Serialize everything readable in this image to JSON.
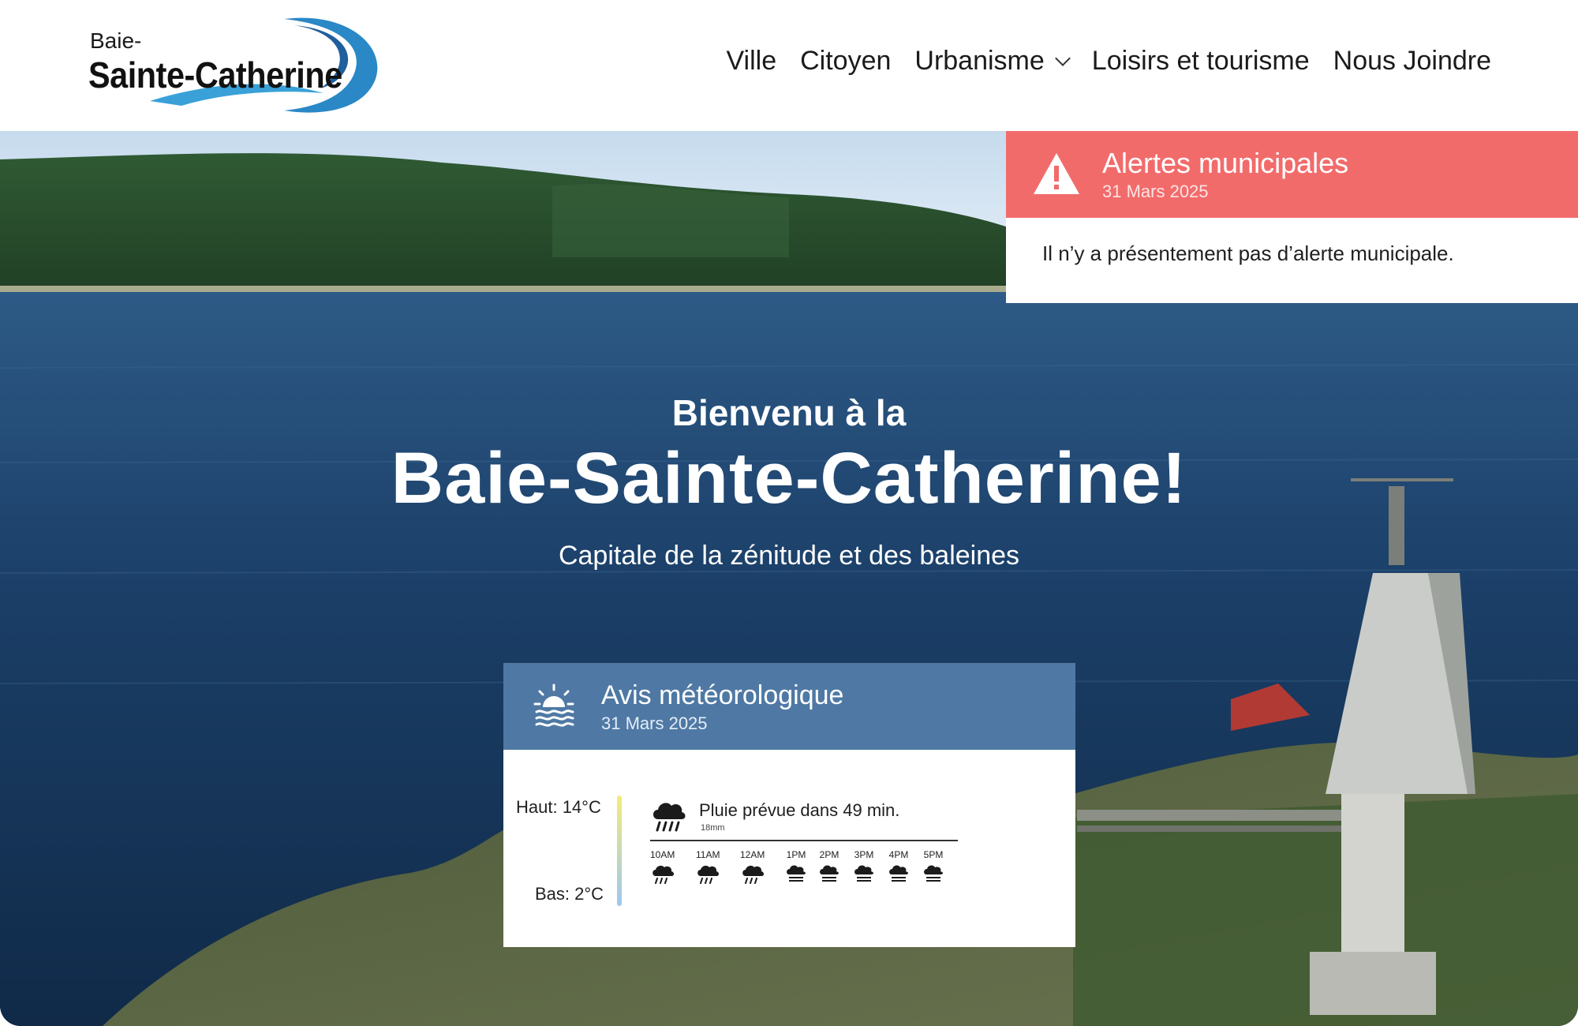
{
  "logo": {
    "top_text": "Baie-",
    "main_text": "Sainte-Catherine"
  },
  "nav": {
    "items": [
      {
        "label": "Ville"
      },
      {
        "label": "Citoyen"
      },
      {
        "label": "Urbanisme",
        "has_dropdown": true
      },
      {
        "label": "Loisirs et tourisme"
      },
      {
        "label": "Nous Joindre"
      }
    ]
  },
  "hero": {
    "pre_title": "Bienvenu à la",
    "title": "Baie-Sainte-Catherine!",
    "subtitle": "Capitale de la zénitude et des baleines"
  },
  "alert": {
    "title": "Alertes municipales",
    "date": "31 Mars 2025",
    "message": "Il n’y a présentement pas d’alerte municipale.",
    "color": "#f26b6b",
    "icon": "warning-icon"
  },
  "weather": {
    "title": "Avis météorologique",
    "date": "31 Mars 2025",
    "high": "Haut: 14°C",
    "low": "Bas: 2°C",
    "rain_text": "Pluie prévue dans 49 min.",
    "rain_amount": "18mm",
    "color": "#4f79a4",
    "icon": "sun-over-water-icon",
    "hourly": [
      {
        "label": "10AM",
        "icon": "heavy-rain-icon"
      },
      {
        "label": "11AM",
        "icon": "heavy-rain-icon"
      },
      {
        "label": "12AM",
        "icon": "heavy-rain-icon"
      },
      {
        "label": "1PM",
        "icon": "light-rain-icon"
      },
      {
        "label": "2PM",
        "icon": "light-rain-icon"
      },
      {
        "label": "3PM",
        "icon": "light-rain-icon"
      },
      {
        "label": "4PM",
        "icon": "light-rain-icon"
      },
      {
        "label": "5PM",
        "icon": "light-rain-icon"
      }
    ]
  }
}
